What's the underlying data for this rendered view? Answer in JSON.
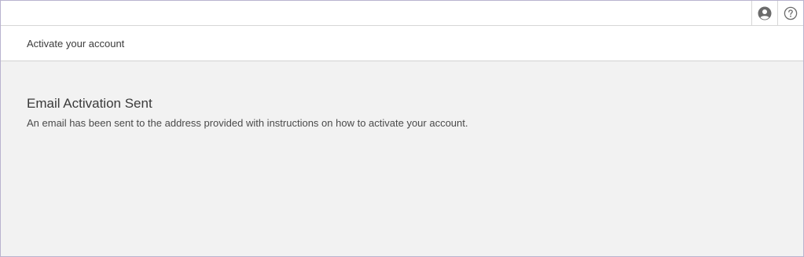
{
  "topbar": {
    "actions": [
      {
        "icon": "user-circle-icon"
      },
      {
        "icon": "help-circle-icon"
      }
    ]
  },
  "subheader": {
    "title": "Activate your account"
  },
  "main": {
    "heading": "Email Activation Sent",
    "message": "An email has been sent to the address provided with instructions on how to activate your account."
  },
  "colors": {
    "background": "#f2f2f2",
    "header_bg": "#ffffff",
    "icon": "#6b6b6b",
    "frame_border": "#b9b3cf"
  }
}
